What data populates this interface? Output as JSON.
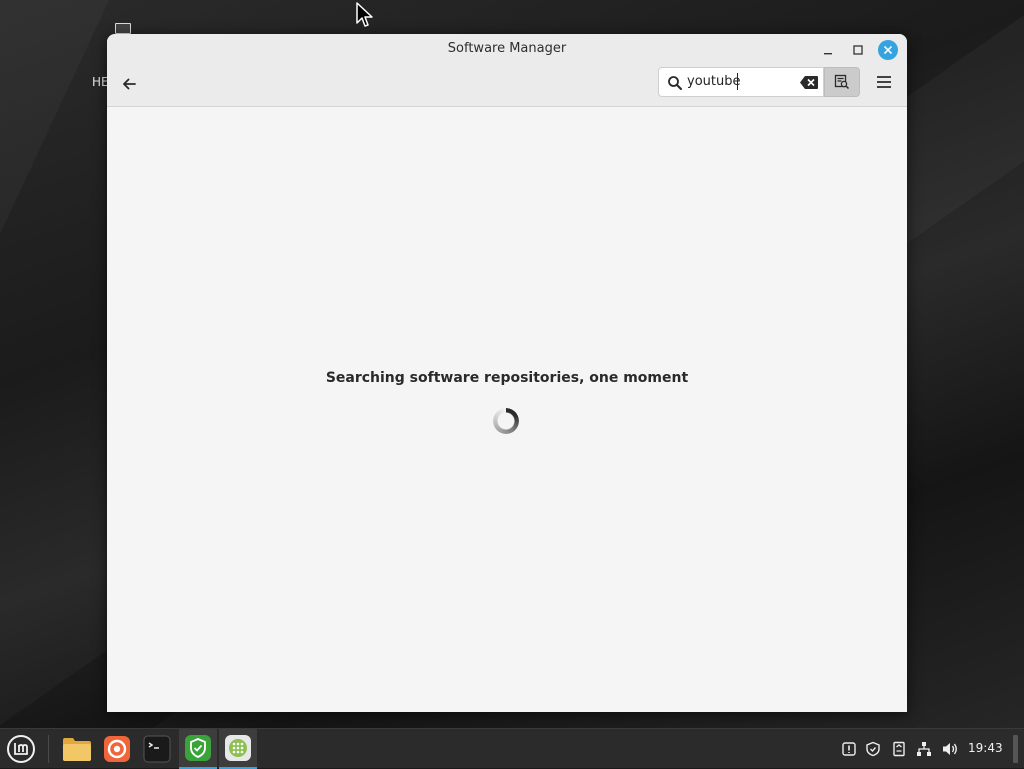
{
  "desktop": {
    "partial_label": "HE"
  },
  "window": {
    "title": "Software Manager",
    "search": {
      "value": "youtube",
      "placeholder": ""
    },
    "status_message": "Searching software repositories, one moment"
  },
  "taskbar": {
    "apps": [
      "mint-menu-icon",
      "files-icon",
      "firefox-icon",
      "terminal-icon",
      "update-manager-icon",
      "software-manager-icon"
    ],
    "tray": [
      "notification-icon",
      "shield-icon",
      "clipboard-icon",
      "network-icon",
      "volume-icon"
    ],
    "clock": "19:43"
  },
  "colors": {
    "accent": "#35a3e0",
    "window_bg": "#f5f5f5",
    "titlebar_bg": "#ebebeb",
    "taskbar_bg": "#2b2b2b"
  }
}
